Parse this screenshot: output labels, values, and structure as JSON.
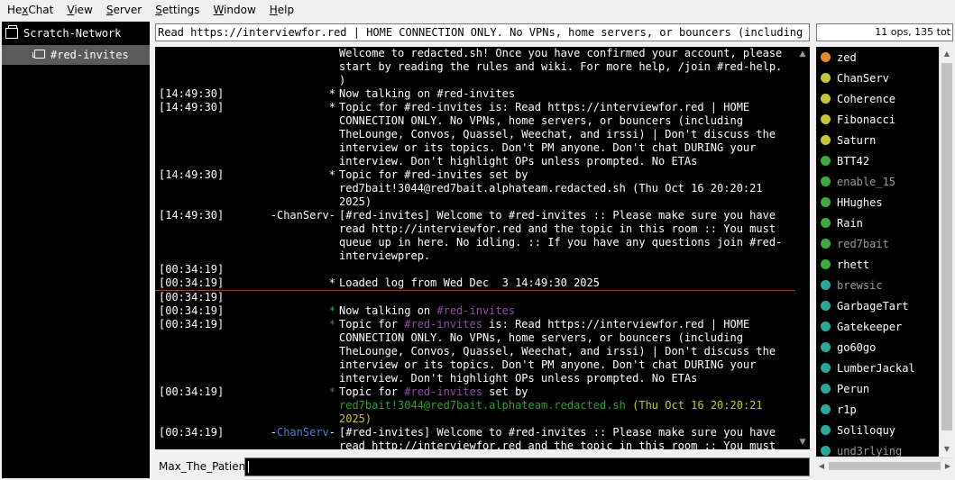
{
  "menu": [
    "HexChat",
    "View",
    "Server",
    "Settings",
    "Window",
    "Help"
  ],
  "menu_underline": [
    2,
    0,
    0,
    0,
    0,
    0
  ],
  "tree": {
    "server": "Scratch-Network",
    "channel": "#red-invites"
  },
  "topic": "Read https://interviewfor.red | HOME CONNECTION ONLY. No VPNs, home servers, or bouncers (including The",
  "user_count": "11 ops, 135 tot",
  "chat_lines": [
    {
      "ts": "",
      "nick": "",
      "msg": "Welcome to redacted.sh! Once you have confirmed your account, please start by reading the rules and wiki. For more help, /join #red-help. )"
    },
    {
      "ts": "[14:49:30]",
      "nick": "*",
      "msg": "Now talking on #red-invites"
    },
    {
      "ts": "[14:49:30]",
      "nick": "*",
      "msg": "Topic for #red-invites is: Read https://interviewfor.red | HOME CONNECTION ONLY. No VPNs, home servers, or bouncers (including TheLounge, Convos, Quassel, Weechat, and irssi) | Don't discuss the interview or its topics. Don't PM anyone. Don't chat DURING your interview. Don't highlight OPs unless prompted. No ETAs"
    },
    {
      "ts": "[14:49:30]",
      "nick": "*",
      "msg": "Topic for #red-invites set by red7bait!3044@red7bait.alphateam.redacted.sh (Thu Oct 16 20:20:21 2025)"
    },
    {
      "ts": "[14:49:30]",
      "nick": "-ChanServ-",
      "msg": "[#red-invites] Welcome to #red-invites :: Please make sure you have read http://interviewfor.red and the topic in this room :: You must queue up in here. No idling. :: If you have any questions join #red-interviewprep."
    },
    {
      "ts": "[00:34:19]",
      "nick": "",
      "msg": ""
    },
    {
      "ts": "[00:34:19]",
      "nick": "*",
      "msg": "Loaded log from Wed Dec  3 14:49:30 2025"
    },
    {
      "ts": "[00:34:19]",
      "nick": "",
      "msg": ""
    },
    {
      "ts": "[00:34:19]",
      "nick": "*",
      "msg": "Now talking on #red-invites"
    },
    {
      "ts": "[00:34:19]",
      "nick": "*",
      "msg": "Topic for #red-invites is: Read https://interviewfor.red | HOME CONNECTION ONLY. No VPNs, home servers, or bouncers (including TheLounge, Convos, Quassel, Weechat, and irssi) | Don't discuss the interview or its topics. Don't PM anyone. Don't chat DURING your interview. Don't highlight OPs unless prompted. No ETAs"
    },
    {
      "ts": "[00:34:19]",
      "nick": "*",
      "msg": "Topic for #red-invites set by red7bait!3044@red7bait.alphateam.redacted.sh (Thu Oct 16 20:20:21 2025)"
    },
    {
      "ts": "[00:34:19]",
      "nick": "-ChanServ-",
      "msg": "[#red-invites] Welcome to #red-invites :: Please make sure you have read http://interviewfor.red and the topic in this room :: You must queue up in here. No idling. :: If you have any questions join #red-interviewprep."
    }
  ],
  "users": [
    {
      "name": "zed",
      "color": "#e8862a",
      "dim": false
    },
    {
      "name": "ChanServ",
      "color": "#c8c43a",
      "dim": false
    },
    {
      "name": "Coherence",
      "color": "#c8c43a",
      "dim": false
    },
    {
      "name": "Fibonacci",
      "color": "#c8c43a",
      "dim": false
    },
    {
      "name": "Saturn",
      "color": "#c8c43a",
      "dim": false
    },
    {
      "name": "BTT42",
      "color": "#3faa3f",
      "dim": false
    },
    {
      "name": "enable_15",
      "color": "#3faa3f",
      "dim": true
    },
    {
      "name": "HHughes",
      "color": "#3faa3f",
      "dim": false
    },
    {
      "name": "Rain",
      "color": "#3faa3f",
      "dim": false
    },
    {
      "name": "red7bait",
      "color": "#3faa3f",
      "dim": true
    },
    {
      "name": "rhett",
      "color": "#3faa3f",
      "dim": false
    },
    {
      "name": "brewsic",
      "color": "#2aa89a",
      "dim": true
    },
    {
      "name": "GarbageTart",
      "color": "#2aa89a",
      "dim": false
    },
    {
      "name": "Gatekeeper",
      "color": "#2aa89a",
      "dim": false
    },
    {
      "name": "go60go",
      "color": "#2aa89a",
      "dim": false
    },
    {
      "name": "LumberJackal",
      "color": "#2aa89a",
      "dim": false
    },
    {
      "name": "Perun",
      "color": "#2aa89a",
      "dim": false
    },
    {
      "name": "r1p",
      "color": "#2aa89a",
      "dim": false
    },
    {
      "name": "Soliloquy",
      "color": "#2aa89a",
      "dim": false
    },
    {
      "name": "und3rlying",
      "color": "#2aa89a",
      "dim": true
    }
  ],
  "input": {
    "nick": "Max_The_Patient",
    "value": ""
  }
}
